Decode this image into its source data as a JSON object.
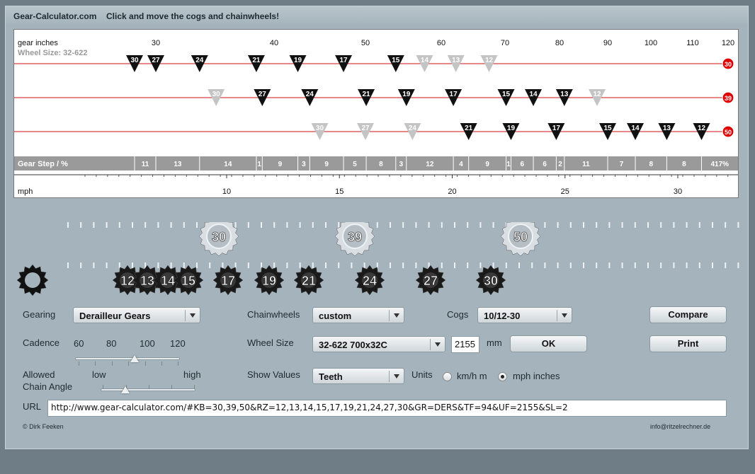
{
  "header": {
    "brand": "Gear-Calculator.com",
    "tagline": "Click and move the cogs and chainwheels!"
  },
  "chart": {
    "gear_inches_label": "gear inches",
    "wheel_size_label": "Wheel Size: 32-622",
    "gear_step_label": "Gear Step / %",
    "mph_label": "mph",
    "top_ticks": [
      "30",
      "40",
      "50",
      "60",
      "70",
      "80",
      "90",
      "100",
      "110",
      "120"
    ],
    "top_tick_values": [
      30,
      40,
      50,
      60,
      70,
      80,
      90,
      100,
      110,
      120
    ],
    "mph_ticks": [
      "10",
      "15",
      "20",
      "25",
      "30"
    ],
    "mph_tick_values": [
      10,
      15,
      20,
      25,
      30
    ],
    "rows": [
      {
        "chainwheel": "30",
        "cogs": [
          {
            "t": "30",
            "gi": 27.0,
            "dim": false
          },
          {
            "t": "27",
            "gi": 30.0,
            "dim": false
          },
          {
            "t": "24",
            "gi": 33.7,
            "dim": false
          },
          {
            "t": "21",
            "gi": 38.5,
            "dim": false
          },
          {
            "t": "19",
            "gi": 42.6,
            "dim": false
          },
          {
            "t": "17",
            "gi": 47.6,
            "dim": false
          },
          {
            "t": "15",
            "gi": 54.0,
            "dim": false
          },
          {
            "t": "14",
            "gi": 57.8,
            "dim": true
          },
          {
            "t": "13",
            "gi": 62.3,
            "dim": true
          },
          {
            "t": "12",
            "gi": 67.5,
            "dim": true
          }
        ]
      },
      {
        "chainwheel": "39",
        "cogs": [
          {
            "t": "30",
            "gi": 35.1,
            "dim": true
          },
          {
            "t": "27",
            "gi": 39.0,
            "dim": false
          },
          {
            "t": "24",
            "gi": 43.9,
            "dim": false
          },
          {
            "t": "21",
            "gi": 50.1,
            "dim": false
          },
          {
            "t": "19",
            "gi": 55.4,
            "dim": false
          },
          {
            "t": "17",
            "gi": 61.9,
            "dim": false
          },
          {
            "t": "15",
            "gi": 70.2,
            "dim": false
          },
          {
            "t": "14",
            "gi": 75.2,
            "dim": false
          },
          {
            "t": "13",
            "gi": 81.0,
            "dim": false
          },
          {
            "t": "12",
            "gi": 87.8,
            "dim": true
          }
        ]
      },
      {
        "chainwheel": "50",
        "cogs": [
          {
            "t": "30",
            "gi": 45.0,
            "dim": true
          },
          {
            "t": "27",
            "gi": 50.0,
            "dim": true
          },
          {
            "t": "24",
            "gi": 56.2,
            "dim": true
          },
          {
            "t": "21",
            "gi": 64.3,
            "dim": false
          },
          {
            "t": "19",
            "gi": 71.1,
            "dim": false
          },
          {
            "t": "17",
            "gi": 79.4,
            "dim": false
          },
          {
            "t": "15",
            "gi": 90.0,
            "dim": false
          },
          {
            "t": "14",
            "gi": 96.4,
            "dim": false
          },
          {
            "t": "13",
            "gi": 103.8,
            "dim": false
          },
          {
            "t": "12",
            "gi": 112.5,
            "dim": false
          }
        ]
      }
    ],
    "gear_steps": [
      {
        "gi": 27.0,
        "v": "11"
      },
      {
        "gi": 30.0,
        "v": "13"
      },
      {
        "gi": 33.7,
        "v": "14"
      },
      {
        "gi": 38.5,
        "v": "1"
      },
      {
        "gi": 39.0,
        "v": "9"
      },
      {
        "gi": 42.6,
        "v": "3"
      },
      {
        "gi": 43.9,
        "v": "9"
      },
      {
        "gi": 47.6,
        "v": "5"
      },
      {
        "gi": 50.1,
        "v": "8"
      },
      {
        "gi": 54.0,
        "v": "3"
      },
      {
        "gi": 55.4,
        "v": "12"
      },
      {
        "gi": 61.9,
        "v": "4"
      },
      {
        "gi": 64.3,
        "v": "9"
      },
      {
        "gi": 70.2,
        "v": "1"
      },
      {
        "gi": 71.1,
        "v": "6"
      },
      {
        "gi": 75.2,
        "v": "6"
      },
      {
        "gi": 79.4,
        "v": "2"
      },
      {
        "gi": 81.0,
        "v": "11"
      },
      {
        "gi": 90.0,
        "v": "7"
      },
      {
        "gi": 96.4,
        "v": "8"
      },
      {
        "gi": 103.8,
        "v": "8"
      },
      {
        "gi": 112.5,
        "v": "417%"
      }
    ]
  },
  "chainwheels": [
    "30",
    "39",
    "50"
  ],
  "cogs": [
    "12",
    "13",
    "14",
    "15",
    "17",
    "19",
    "21",
    "24",
    "27",
    "30"
  ],
  "controls": {
    "gearing_label": "Gearing",
    "gearing_value": "Derailleur Gears",
    "chainwheels_label": "Chainwheels",
    "chainwheels_value": "custom",
    "cogs_label": "Cogs",
    "cogs_value": "10/12-30",
    "compare": "Compare",
    "print": "Print",
    "cadence_label": "Cadence",
    "cadence_ticks": [
      "60",
      "80",
      "100",
      "120"
    ],
    "cadence_value": 94,
    "wheel_size_label": "Wheel Size",
    "wheel_size_value": "32-622  700x32C",
    "circumference": "2155",
    "mm": "mm",
    "ok": "OK",
    "chain_angle_label_1": "Allowed",
    "chain_angle_label_2": "Chain Angle",
    "chain_angle_low": "low",
    "chain_angle_high": "high",
    "chain_angle_level": 0.25,
    "show_values_label": "Show Values",
    "show_values_value": "Teeth",
    "units_label": "Units",
    "unit_kmh": "km/h m",
    "unit_mph": "mph inches",
    "url_label": "URL",
    "url_value": "http://www.gear-calculator.com/#KB=30,39,50&RZ=12,13,14,15,17,19,21,24,27,30&GR=DERS&TF=94&UF=2155&SL=2"
  },
  "footer": {
    "left": "© Dirk Feeken",
    "right": "info@ritzelrechner.de"
  },
  "colors": {
    "line": "#cc1111",
    "dim": "#c4c4c4",
    "dark": "#111111",
    "bar": "#9a9a9a"
  }
}
